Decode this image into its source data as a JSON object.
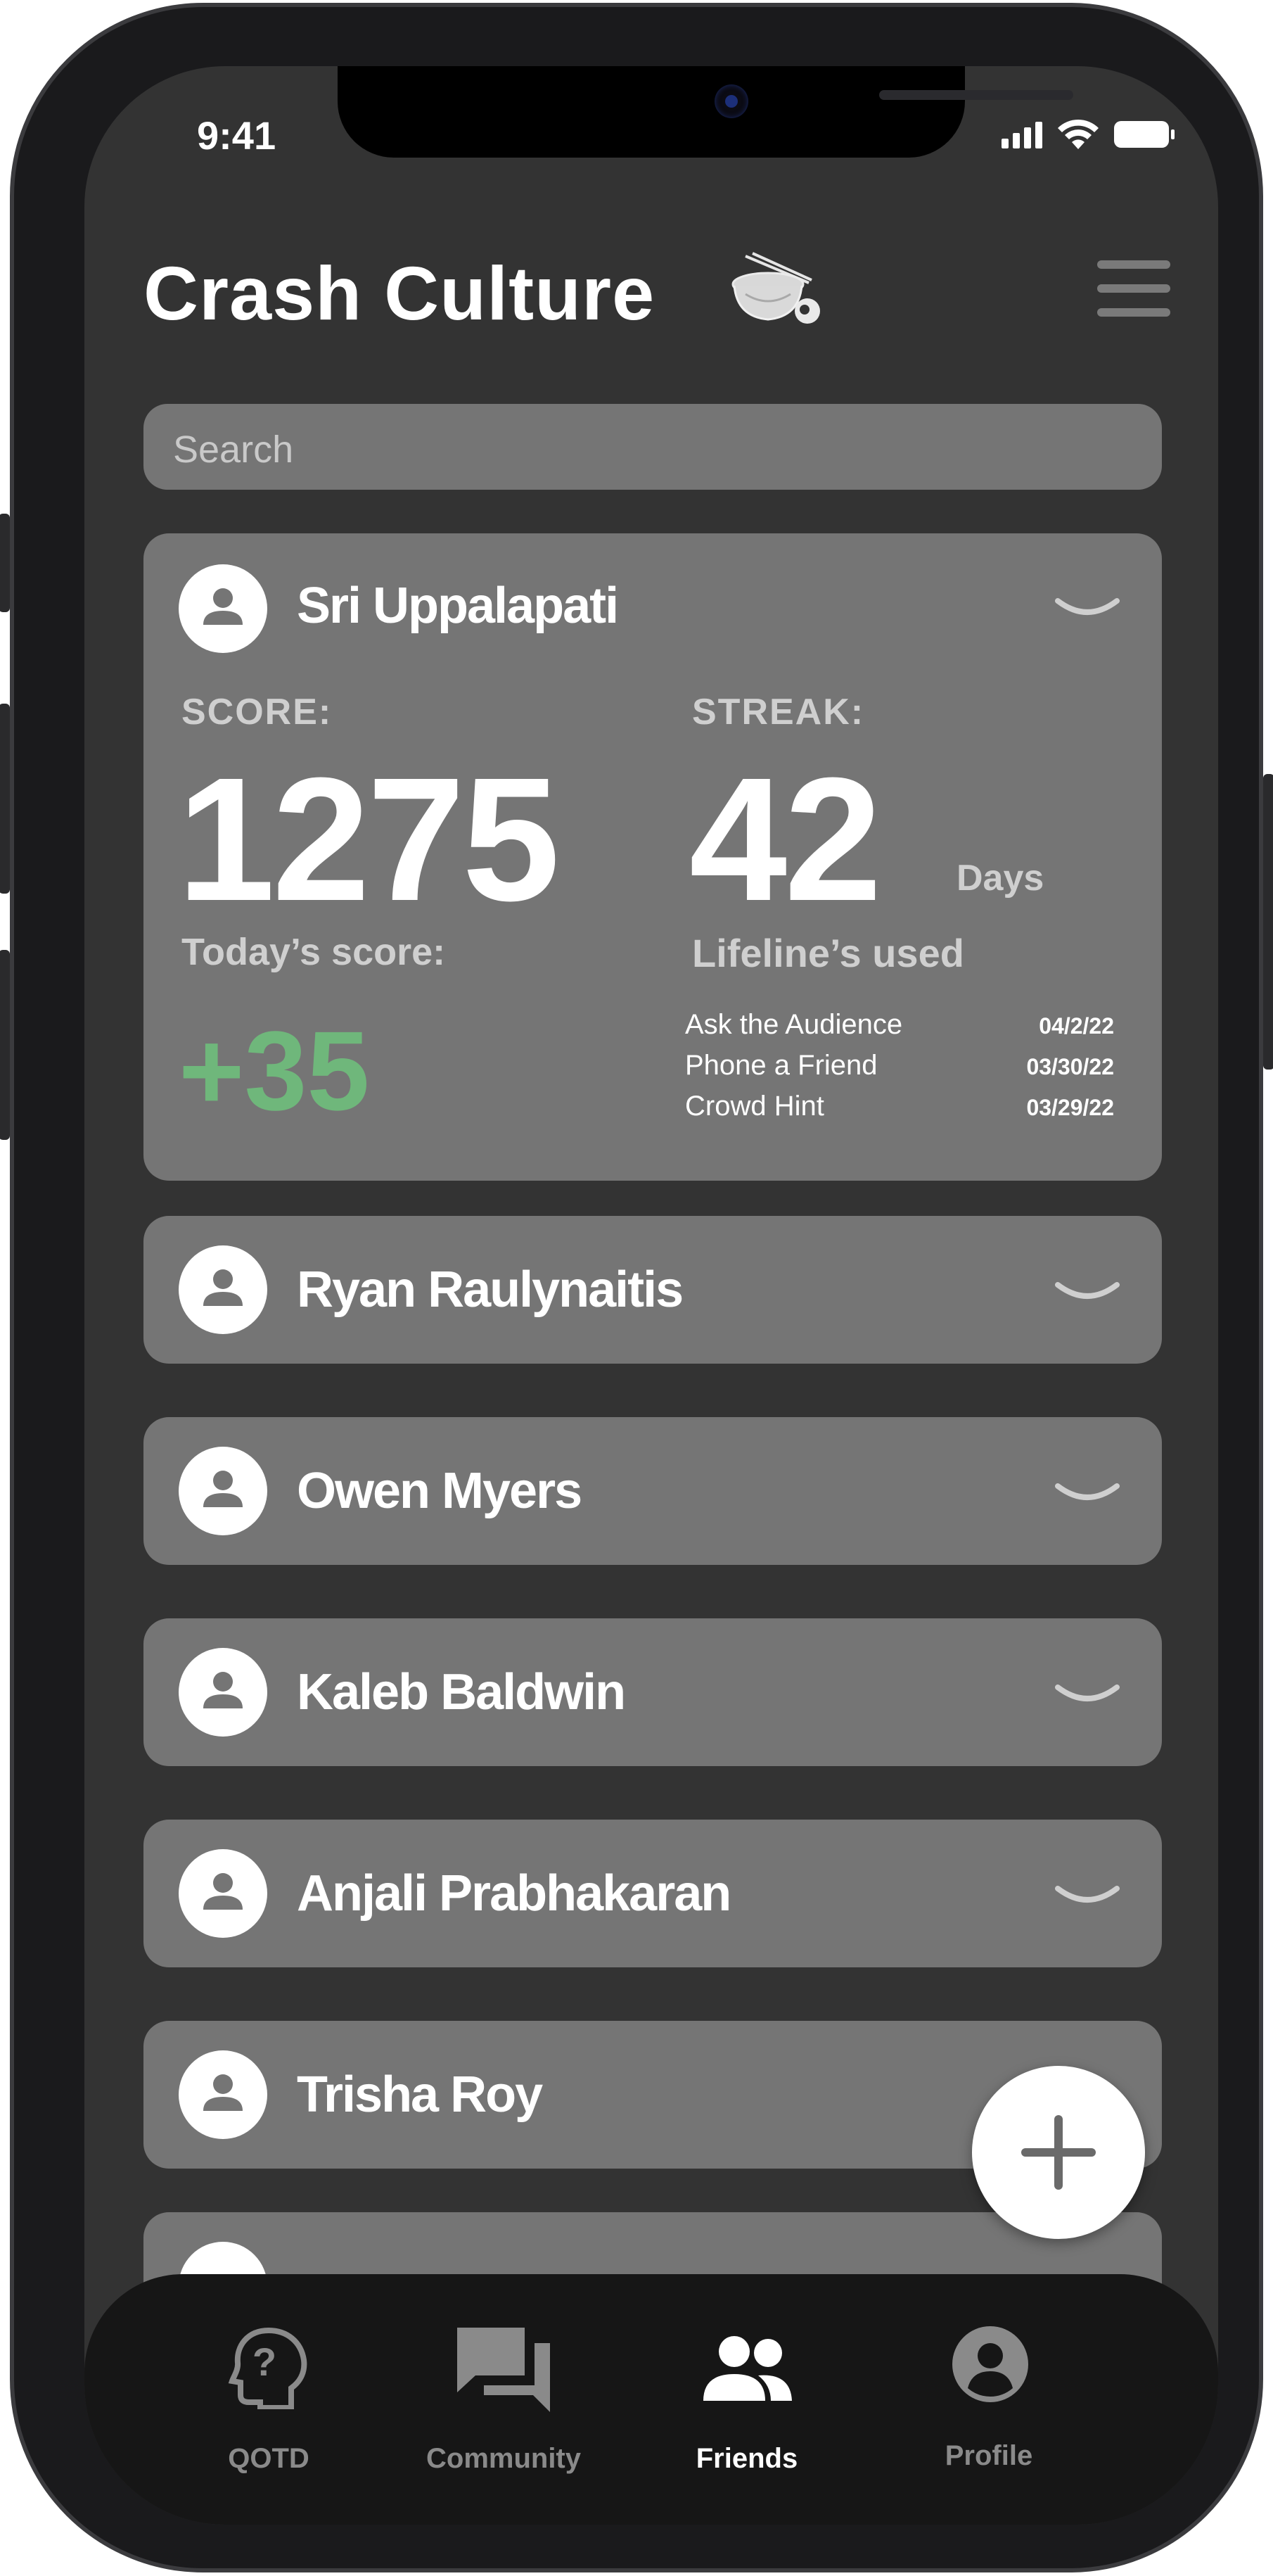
{
  "status_bar": {
    "time": "9:41"
  },
  "header": {
    "title": "Crash Culture"
  },
  "search": {
    "placeholder": "Search"
  },
  "expanded_friend": {
    "name": "Sri Uppalapati",
    "score_label": "SCORE:",
    "score": "1275",
    "streak_label": "STREAK:",
    "streak": "42",
    "streak_unit": "Days",
    "today_label": "Today’s score:",
    "today_score": "+35",
    "lifelines_label": "Lifeline’s used",
    "lifelines": [
      {
        "name": "Ask the Audience",
        "date": "04/2/22"
      },
      {
        "name": "Phone a Friend",
        "date": "03/30/22"
      },
      {
        "name": "Crowd Hint",
        "date": "03/29/22"
      }
    ]
  },
  "friends": [
    {
      "name": "Ryan Raulynaitis"
    },
    {
      "name": "Owen Myers"
    },
    {
      "name": "Kaleb Baldwin"
    },
    {
      "name": "Anjali Prabhakaran"
    },
    {
      "name": "Trisha Roy"
    }
  ],
  "tabs": [
    {
      "label": "QOTD",
      "icon": "question-head-icon",
      "active": false
    },
    {
      "label": "Community",
      "icon": "chat-bubbles-icon",
      "active": false
    },
    {
      "label": "Friends",
      "icon": "people-icon",
      "active": true
    },
    {
      "label": "Profile",
      "icon": "profile-icon",
      "active": false
    }
  ],
  "colors": {
    "background": "#333333",
    "card": "#757575",
    "positive": "#6fb77b",
    "tabbar": "#161616",
    "tab_inactive": "#8a8a8a",
    "tab_active": "#ffffff"
  }
}
